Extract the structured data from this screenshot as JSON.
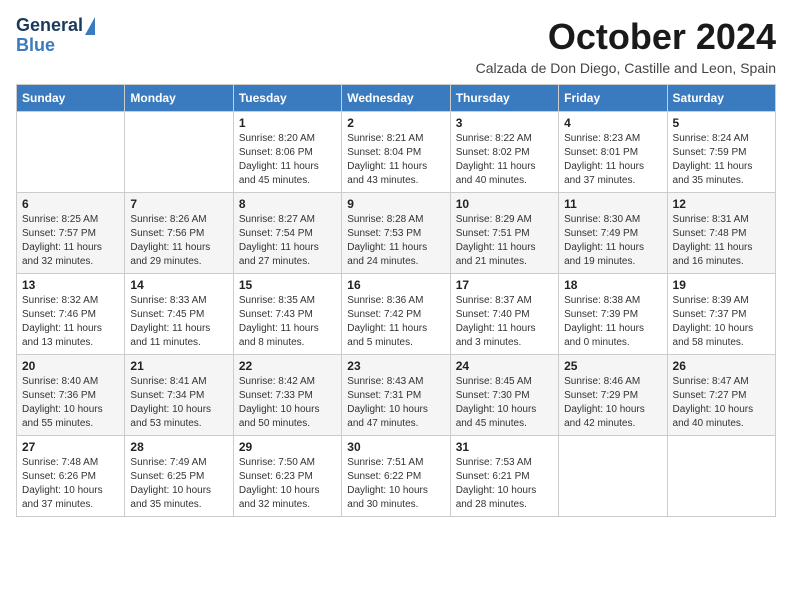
{
  "header": {
    "logo_line1": "General",
    "logo_line2": "Blue",
    "month": "October 2024",
    "location": "Calzada de Don Diego, Castille and Leon, Spain"
  },
  "weekdays": [
    "Sunday",
    "Monday",
    "Tuesday",
    "Wednesday",
    "Thursday",
    "Friday",
    "Saturday"
  ],
  "weeks": [
    [
      {
        "day": "",
        "info": ""
      },
      {
        "day": "",
        "info": ""
      },
      {
        "day": "1",
        "info": "Sunrise: 8:20 AM\nSunset: 8:06 PM\nDaylight: 11 hours and 45 minutes."
      },
      {
        "day": "2",
        "info": "Sunrise: 8:21 AM\nSunset: 8:04 PM\nDaylight: 11 hours and 43 minutes."
      },
      {
        "day": "3",
        "info": "Sunrise: 8:22 AM\nSunset: 8:02 PM\nDaylight: 11 hours and 40 minutes."
      },
      {
        "day": "4",
        "info": "Sunrise: 8:23 AM\nSunset: 8:01 PM\nDaylight: 11 hours and 37 minutes."
      },
      {
        "day": "5",
        "info": "Sunrise: 8:24 AM\nSunset: 7:59 PM\nDaylight: 11 hours and 35 minutes."
      }
    ],
    [
      {
        "day": "6",
        "info": "Sunrise: 8:25 AM\nSunset: 7:57 PM\nDaylight: 11 hours and 32 minutes."
      },
      {
        "day": "7",
        "info": "Sunrise: 8:26 AM\nSunset: 7:56 PM\nDaylight: 11 hours and 29 minutes."
      },
      {
        "day": "8",
        "info": "Sunrise: 8:27 AM\nSunset: 7:54 PM\nDaylight: 11 hours and 27 minutes."
      },
      {
        "day": "9",
        "info": "Sunrise: 8:28 AM\nSunset: 7:53 PM\nDaylight: 11 hours and 24 minutes."
      },
      {
        "day": "10",
        "info": "Sunrise: 8:29 AM\nSunset: 7:51 PM\nDaylight: 11 hours and 21 minutes."
      },
      {
        "day": "11",
        "info": "Sunrise: 8:30 AM\nSunset: 7:49 PM\nDaylight: 11 hours and 19 minutes."
      },
      {
        "day": "12",
        "info": "Sunrise: 8:31 AM\nSunset: 7:48 PM\nDaylight: 11 hours and 16 minutes."
      }
    ],
    [
      {
        "day": "13",
        "info": "Sunrise: 8:32 AM\nSunset: 7:46 PM\nDaylight: 11 hours and 13 minutes."
      },
      {
        "day": "14",
        "info": "Sunrise: 8:33 AM\nSunset: 7:45 PM\nDaylight: 11 hours and 11 minutes."
      },
      {
        "day": "15",
        "info": "Sunrise: 8:35 AM\nSunset: 7:43 PM\nDaylight: 11 hours and 8 minutes."
      },
      {
        "day": "16",
        "info": "Sunrise: 8:36 AM\nSunset: 7:42 PM\nDaylight: 11 hours and 5 minutes."
      },
      {
        "day": "17",
        "info": "Sunrise: 8:37 AM\nSunset: 7:40 PM\nDaylight: 11 hours and 3 minutes."
      },
      {
        "day": "18",
        "info": "Sunrise: 8:38 AM\nSunset: 7:39 PM\nDaylight: 11 hours and 0 minutes."
      },
      {
        "day": "19",
        "info": "Sunrise: 8:39 AM\nSunset: 7:37 PM\nDaylight: 10 hours and 58 minutes."
      }
    ],
    [
      {
        "day": "20",
        "info": "Sunrise: 8:40 AM\nSunset: 7:36 PM\nDaylight: 10 hours and 55 minutes."
      },
      {
        "day": "21",
        "info": "Sunrise: 8:41 AM\nSunset: 7:34 PM\nDaylight: 10 hours and 53 minutes."
      },
      {
        "day": "22",
        "info": "Sunrise: 8:42 AM\nSunset: 7:33 PM\nDaylight: 10 hours and 50 minutes."
      },
      {
        "day": "23",
        "info": "Sunrise: 8:43 AM\nSunset: 7:31 PM\nDaylight: 10 hours and 47 minutes."
      },
      {
        "day": "24",
        "info": "Sunrise: 8:45 AM\nSunset: 7:30 PM\nDaylight: 10 hours and 45 minutes."
      },
      {
        "day": "25",
        "info": "Sunrise: 8:46 AM\nSunset: 7:29 PM\nDaylight: 10 hours and 42 minutes."
      },
      {
        "day": "26",
        "info": "Sunrise: 8:47 AM\nSunset: 7:27 PM\nDaylight: 10 hours and 40 minutes."
      }
    ],
    [
      {
        "day": "27",
        "info": "Sunrise: 7:48 AM\nSunset: 6:26 PM\nDaylight: 10 hours and 37 minutes."
      },
      {
        "day": "28",
        "info": "Sunrise: 7:49 AM\nSunset: 6:25 PM\nDaylight: 10 hours and 35 minutes."
      },
      {
        "day": "29",
        "info": "Sunrise: 7:50 AM\nSunset: 6:23 PM\nDaylight: 10 hours and 32 minutes."
      },
      {
        "day": "30",
        "info": "Sunrise: 7:51 AM\nSunset: 6:22 PM\nDaylight: 10 hours and 30 minutes."
      },
      {
        "day": "31",
        "info": "Sunrise: 7:53 AM\nSunset: 6:21 PM\nDaylight: 10 hours and 28 minutes."
      },
      {
        "day": "",
        "info": ""
      },
      {
        "day": "",
        "info": ""
      }
    ]
  ]
}
